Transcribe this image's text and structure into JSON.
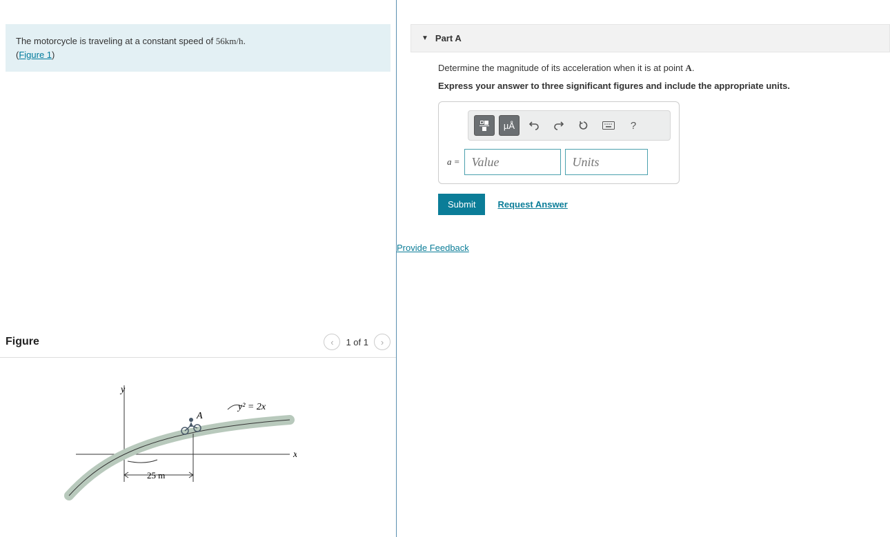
{
  "problem": {
    "text_prefix": "The motorcycle is traveling at a constant speed of ",
    "speed": "56km/h",
    "text_suffix": ".",
    "figure_ref_open": "(",
    "figure_ref": "Figure 1",
    "figure_ref_close": ")"
  },
  "figure": {
    "title": "Figure",
    "pager": "1 of 1",
    "labels": {
      "y": "y",
      "x": "x",
      "A": "A",
      "curve": "y² = 2x",
      "dist": "25 m"
    }
  },
  "partA": {
    "header": "Part A",
    "prompt_prefix": "Determine the magnitude of its acceleration when it is at point ",
    "prompt_point": "A",
    "prompt_suffix": ".",
    "instruction": "Express your answer to three significant figures and include the appropriate units.",
    "a_eq": "a =",
    "value_placeholder": "Value",
    "units_placeholder": "Units",
    "toolbar": {
      "units_btn": "µÅ",
      "help": "?"
    },
    "submit": "Submit",
    "request": "Request Answer"
  },
  "feedback": "Provide Feedback"
}
